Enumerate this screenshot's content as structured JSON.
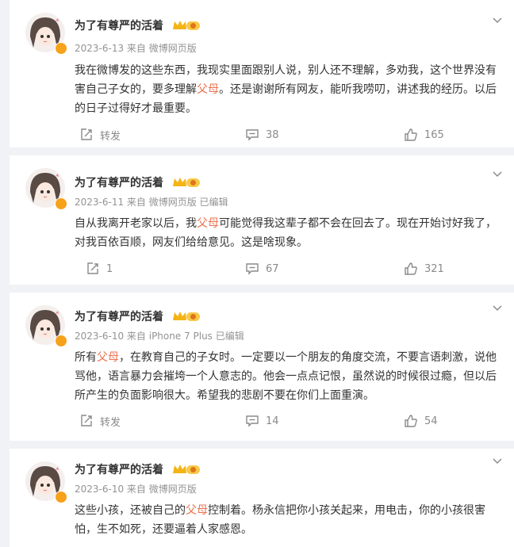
{
  "posts": [
    {
      "user": "为了有尊严的活着",
      "meta": "2023-6-13 来自 微博网页版",
      "content": {
        "before": "我在微博发的这些东西，我现实里面跟别人说，别人还不理解，多劝我，这个世界没有害自己子女的，要多理解",
        "highlight": "父母",
        "after": "。还是谢谢所有网友，能听我唠叨，讲述我的经历。以后的日子过得好才最重要。"
      },
      "repost": "转发",
      "comments": "38",
      "likes": "165"
    },
    {
      "user": "为了有尊严的活着",
      "meta": "2023-6-11 来自 微博网页版 已编辑",
      "content": {
        "before": "自从我离开老家以后，我",
        "highlight": "父母",
        "after": "可能觉得我这辈子都不会在回去了。现在开始讨好我了，对我百依百顺，网友们给给意见。这是啥现象。"
      },
      "repost": "1",
      "comments": "67",
      "likes": "321"
    },
    {
      "user": "为了有尊严的活着",
      "meta": "2023-6-10 来自 iPhone 7 Plus 已编辑",
      "content": {
        "before": "所有",
        "highlight": "父母",
        "after": "，在教育自己的子女时。一定要以一个朋友的角度交流，不要言语刺激，说他骂他，语言暴力会摧垮一个人意志的。他会一点点记恨，虽然说的时候很过瘾，但以后所产生的负面影响很大。希望我的悲剧不要在你们上面重演。"
      },
      "repost": "转发",
      "comments": "14",
      "likes": "54"
    },
    {
      "user": "为了有尊严的活着",
      "meta": "2023-6-10 来自 微博网页版",
      "content": {
        "before": "这些小孩，还被自己的",
        "highlight": "父母",
        "after": "控制着。杨永信把你小孩关起来，用电击，你的小孩很害怕，生不如死，还要逼着人家感恩。"
      }
    }
  ]
}
